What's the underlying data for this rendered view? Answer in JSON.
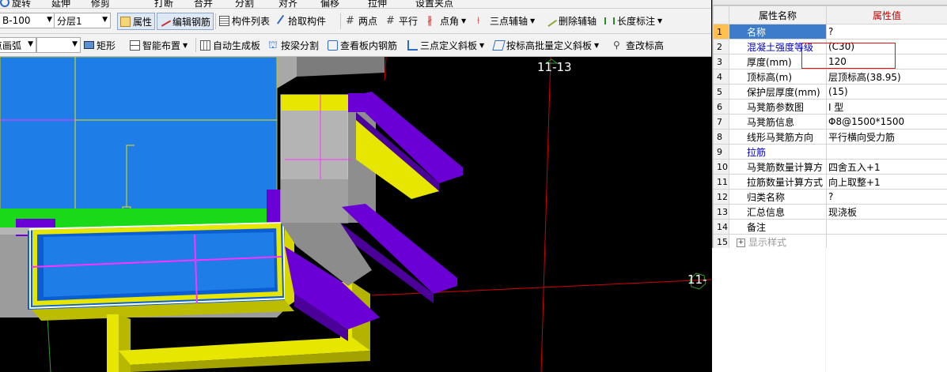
{
  "toolbar_top": {
    "items": [
      "旋转",
      "延伸",
      "修剪",
      "打断",
      "合并",
      "分割",
      "对齐",
      "偏移",
      "拉伸",
      "设置夹点"
    ]
  },
  "toolbar1": {
    "component_select": "B-100",
    "layer_select": "分层1",
    "buttons": {
      "properties": "属性",
      "edit_rebar": "编辑钢筋",
      "component_list": "构件列表",
      "pick_component": "拾取构件",
      "two_points": "两点",
      "parallel": "平行",
      "point_angle": "点角",
      "three_point_aux": "三点辅轴",
      "delete_aux": "删除辅轴",
      "length_dim": "长度标注"
    }
  },
  "toolbar2": {
    "arc_select": "点画弧",
    "blank_select": "",
    "buttons": {
      "rectangle": "矩形",
      "smart_layout": "智能布置",
      "auto_generate": "自动生成板",
      "split_by_beam": "按梁分割",
      "view_slab_rebar": "查看板内钢筋",
      "three_point_slope": "三点定义斜板",
      "batch_slope": "按标高批量定义斜板",
      "modify_elevation": "查改标高"
    }
  },
  "viewport": {
    "axis_labels": [
      "11-13",
      "11-"
    ]
  },
  "properties": {
    "header_name": "属性名称",
    "header_value": "属性值",
    "rows": [
      {
        "num": "1",
        "name": "名称",
        "value": "?",
        "style": "selected"
      },
      {
        "num": "2",
        "name": "混凝土强度等级",
        "value": "(C30)",
        "style": "link"
      },
      {
        "num": "3",
        "name": "厚度(mm)",
        "value": "120",
        "style": "normal"
      },
      {
        "num": "4",
        "name": "顶标高(m)",
        "value": "层顶标高(38.95)",
        "style": "normal"
      },
      {
        "num": "5",
        "name": "保护层厚度(mm)",
        "value": "(15)",
        "style": "normal"
      },
      {
        "num": "6",
        "name": "马凳筋参数图",
        "value": "I 型",
        "style": "normal"
      },
      {
        "num": "7",
        "name": "马凳筋信息",
        "value": "Φ8@1500*1500",
        "style": "normal"
      },
      {
        "num": "8",
        "name": "线形马凳筋方向",
        "value": "平行横向受力筋",
        "style": "normal"
      },
      {
        "num": "9",
        "name": "拉筋",
        "value": "",
        "style": "link"
      },
      {
        "num": "10",
        "name": "马凳筋数量计算方",
        "value": "四舍五入+1",
        "style": "normal"
      },
      {
        "num": "11",
        "name": "拉筋数量计算方式",
        "value": "向上取整+1",
        "style": "normal"
      },
      {
        "num": "12",
        "name": "归类名称",
        "value": "?",
        "style": "normal"
      },
      {
        "num": "13",
        "name": "汇总信息",
        "value": "现浇板",
        "style": "normal"
      },
      {
        "num": "14",
        "name": "备注",
        "value": "",
        "style": "normal"
      },
      {
        "num": "15",
        "name": "显示样式",
        "value": "",
        "style": "group"
      }
    ]
  },
  "colors": {
    "slab_blue": "#1e7de6",
    "beam_purple": "#6b00d6",
    "wall_yellow": "#e6e600",
    "rebar_magenta": "#ff33ff",
    "column_gray": "#b4b4b4",
    "grid_red": "#d40000",
    "highlight_green": "#19d919",
    "selected_row": "#3d7ccb"
  }
}
